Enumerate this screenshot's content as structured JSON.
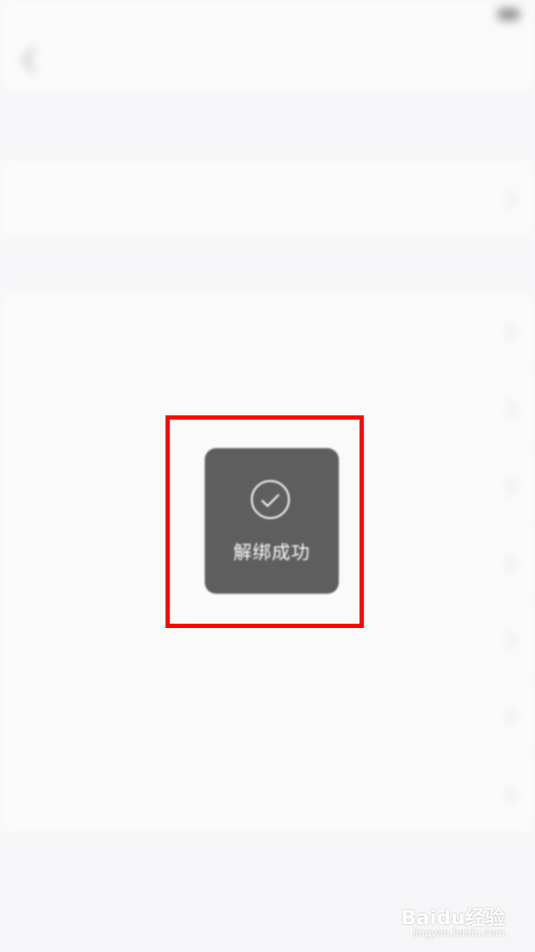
{
  "status_bar": {
    "carrier": "",
    "time": "",
    "battery": ""
  },
  "nav": {
    "title": ""
  },
  "notice": "",
  "cancel_account": {
    "label": ""
  },
  "bound_section": {
    "label": "",
    "items": [
      {
        "label": "",
        "value": ""
      },
      {
        "label": "",
        "value": ""
      },
      {
        "label": "",
        "value": ""
      },
      {
        "label": "",
        "value": ""
      },
      {
        "label": "",
        "value": ""
      },
      {
        "label": "",
        "value": ""
      },
      {
        "label": "",
        "value": ""
      }
    ]
  },
  "footer_note": "",
  "toast": {
    "icon": "check-circle-icon",
    "text": "解绑成功"
  },
  "highlight_color": "#ff0000",
  "watermark": {
    "text": "Baidu经验",
    "sub": "jingyan.baidu.com"
  }
}
